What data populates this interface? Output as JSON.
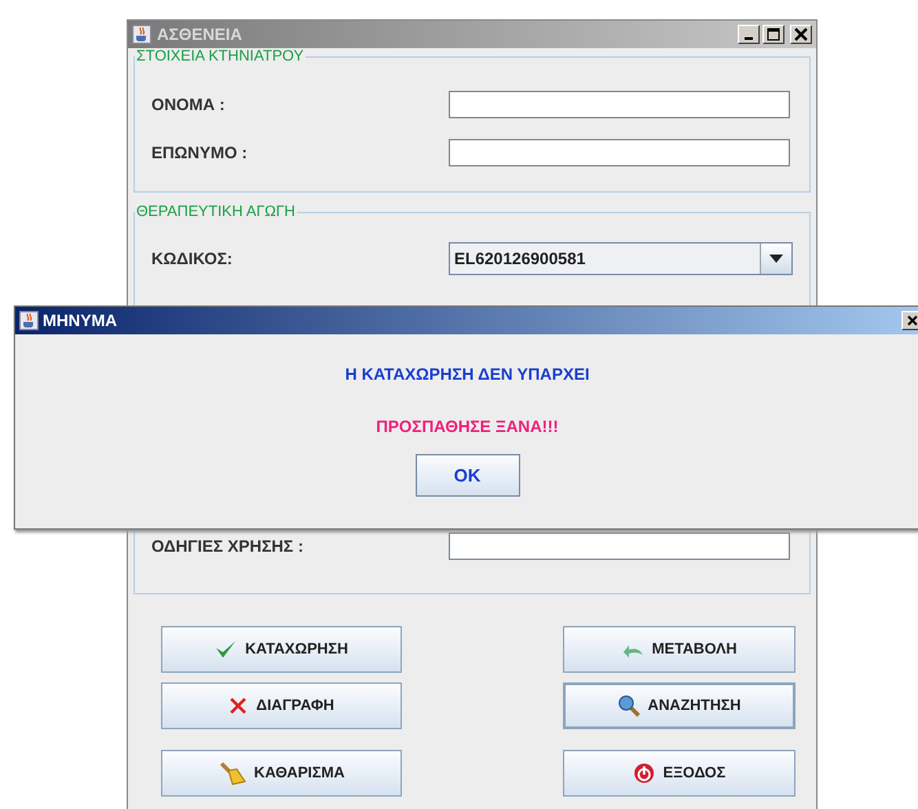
{
  "window": {
    "title": "ΑΣΘΕΝΕΙΑ",
    "active": false
  },
  "sections": [
    {
      "legend": "ΣΤΟΙΧΕΙΑ ΚΤΗΝΙΑΤΡΟΥ",
      "fields": [
        {
          "kind": "text",
          "label": "ΟΝΟΜΑ :"
        },
        {
          "kind": "text",
          "label": "ΕΠΩΝΥΜΟ :"
        }
      ]
    },
    {
      "legend": "ΘΕΡΑΠΕΥΤΙΚΗ ΑΓΩΓΗ",
      "fields": [
        {
          "kind": "combo",
          "label": "ΚΩΔΙΚΟΣ:",
          "value": "EL620126900581"
        },
        {
          "kind": "hidden"
        },
        {
          "kind": "text",
          "label": "ΟΔΗΓΙΕΣ ΧΡΗΣΗΣ :"
        }
      ]
    }
  ],
  "buttons": [
    "ΚΑΤΑΧΩΡΗΣΗ",
    "ΜΕΤΑΒΟΛΗ",
    "ΔΙΑΓΡΑΦΗ",
    "ΑΝΑΖΗΤΗΣΗ",
    "ΚΑΘΑΡΙΣΜΑ",
    "ΕΞΟΔΟΣ"
  ],
  "dialog": {
    "title": "ΜΗΝΥΜΑ",
    "message": "Η ΚΑΤΑΧΩΡΗΣΗ ΔΕΝ ΥΠΑΡΧΕΙ",
    "warning": "ΠΡΟΣΠΑΘΗΣΕ ΞΑΝΑ!!!",
    "button": "OK"
  }
}
